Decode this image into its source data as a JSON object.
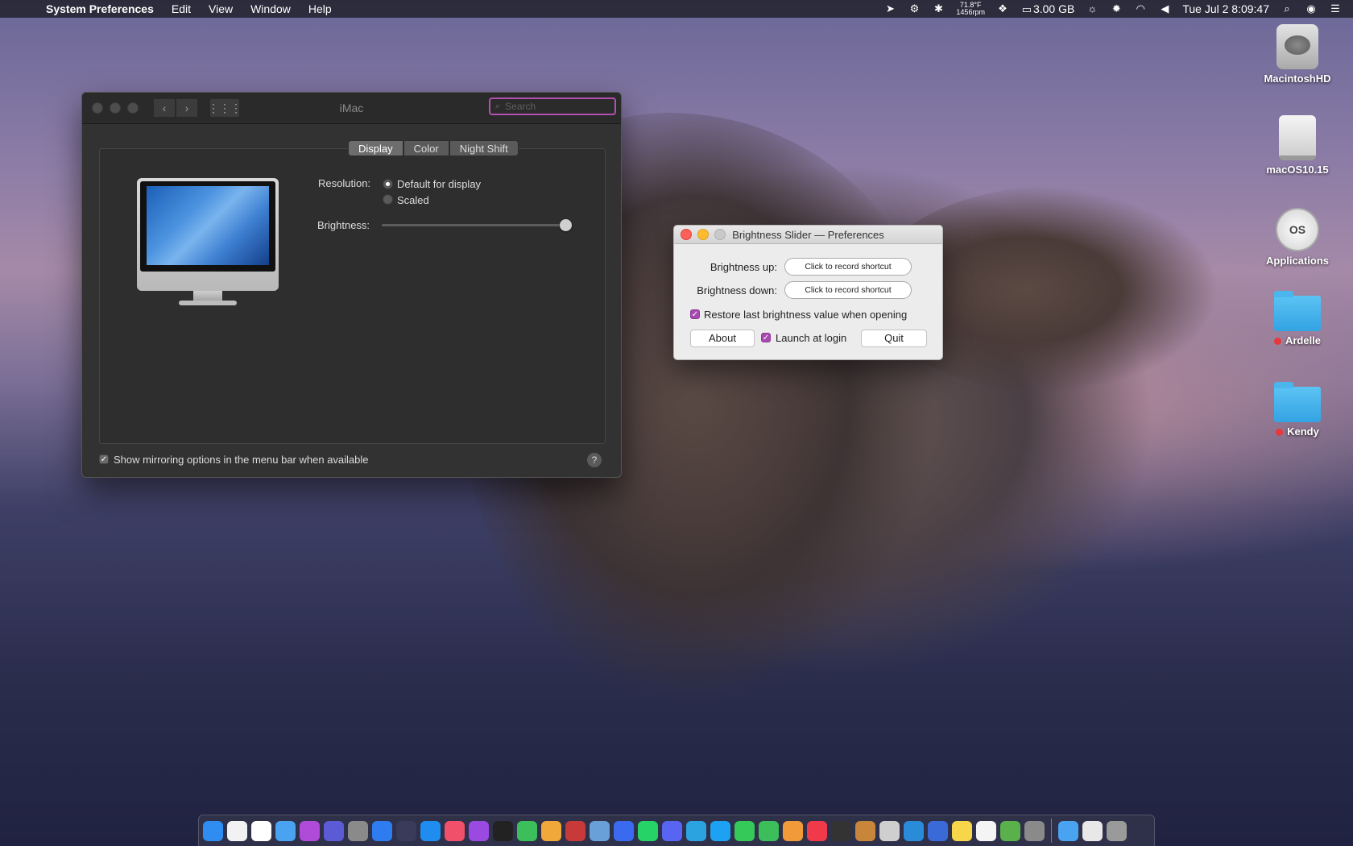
{
  "menubar": {
    "app_name": "System Preferences",
    "menus": [
      "Edit",
      "View",
      "Window",
      "Help"
    ],
    "temp_line1": "71.8°F",
    "temp_line2": "1456rpm",
    "memory": "3.00 GB",
    "datetime": "Tue Jul 2  8:09:47"
  },
  "sysprefs": {
    "title": "iMac",
    "search_placeholder": "Search",
    "tabs": [
      "Display",
      "Color",
      "Night Shift"
    ],
    "active_tab": "Display",
    "resolution_label": "Resolution:",
    "resolution_options": [
      "Default for display",
      "Scaled"
    ],
    "resolution_selected": "Default for display",
    "brightness_label": "Brightness:",
    "brightness_value": 1.0,
    "mirroring_label": "Show mirroring options in the menu bar when available",
    "mirroring_checked": true,
    "help": "?"
  },
  "brightness_prefs": {
    "title": "Brightness Slider — Preferences",
    "up_label": "Brightness up:",
    "down_label": "Brightness down:",
    "record_label": "Click to record shortcut",
    "restore_label": "Restore last brightness value when opening",
    "restore_checked": true,
    "about_label": "About",
    "launch_label": "Launch at login",
    "launch_checked": true,
    "quit_label": "Quit"
  },
  "desktop": {
    "icons": [
      {
        "name": "MacintoshHD",
        "icon": "hard-disk-icon"
      },
      {
        "name": "macOS10.15",
        "icon": "external-drive-icon"
      },
      {
        "name": "Applications",
        "icon": "macos-installer-disk-icon"
      },
      {
        "name": "Ardelle",
        "icon": "folder-icon",
        "tag": "red"
      },
      {
        "name": "Kendy",
        "icon": "folder-icon",
        "tag": "red"
      }
    ]
  },
  "colors": {
    "accent": "#a749b0",
    "close": "#fe5f57",
    "minimize": "#febc2e",
    "zoom_inactive": "#c9c9c9"
  },
  "dock": {
    "apps": [
      "Finder",
      "Clock",
      "Calendar",
      "Weather",
      "Pixelmator",
      "Siri",
      "Launchpad",
      "Safari",
      "Mail",
      "App Store",
      "Music",
      "Podcasts",
      "TV",
      "Find My",
      "Photos",
      "Photo Booth",
      "Preview",
      "Messenger",
      "WhatsApp",
      "Discord",
      "Telegram",
      "Twitter",
      "Messages",
      "FaceTime",
      "Home",
      "News",
      "Stocks",
      "Books",
      "Disk Utility",
      "Edge",
      "Keynote",
      "Notes",
      "Reminders",
      "Maps",
      "System Preferences",
      "Downloads",
      "Mail Folder",
      "Trash"
    ]
  }
}
